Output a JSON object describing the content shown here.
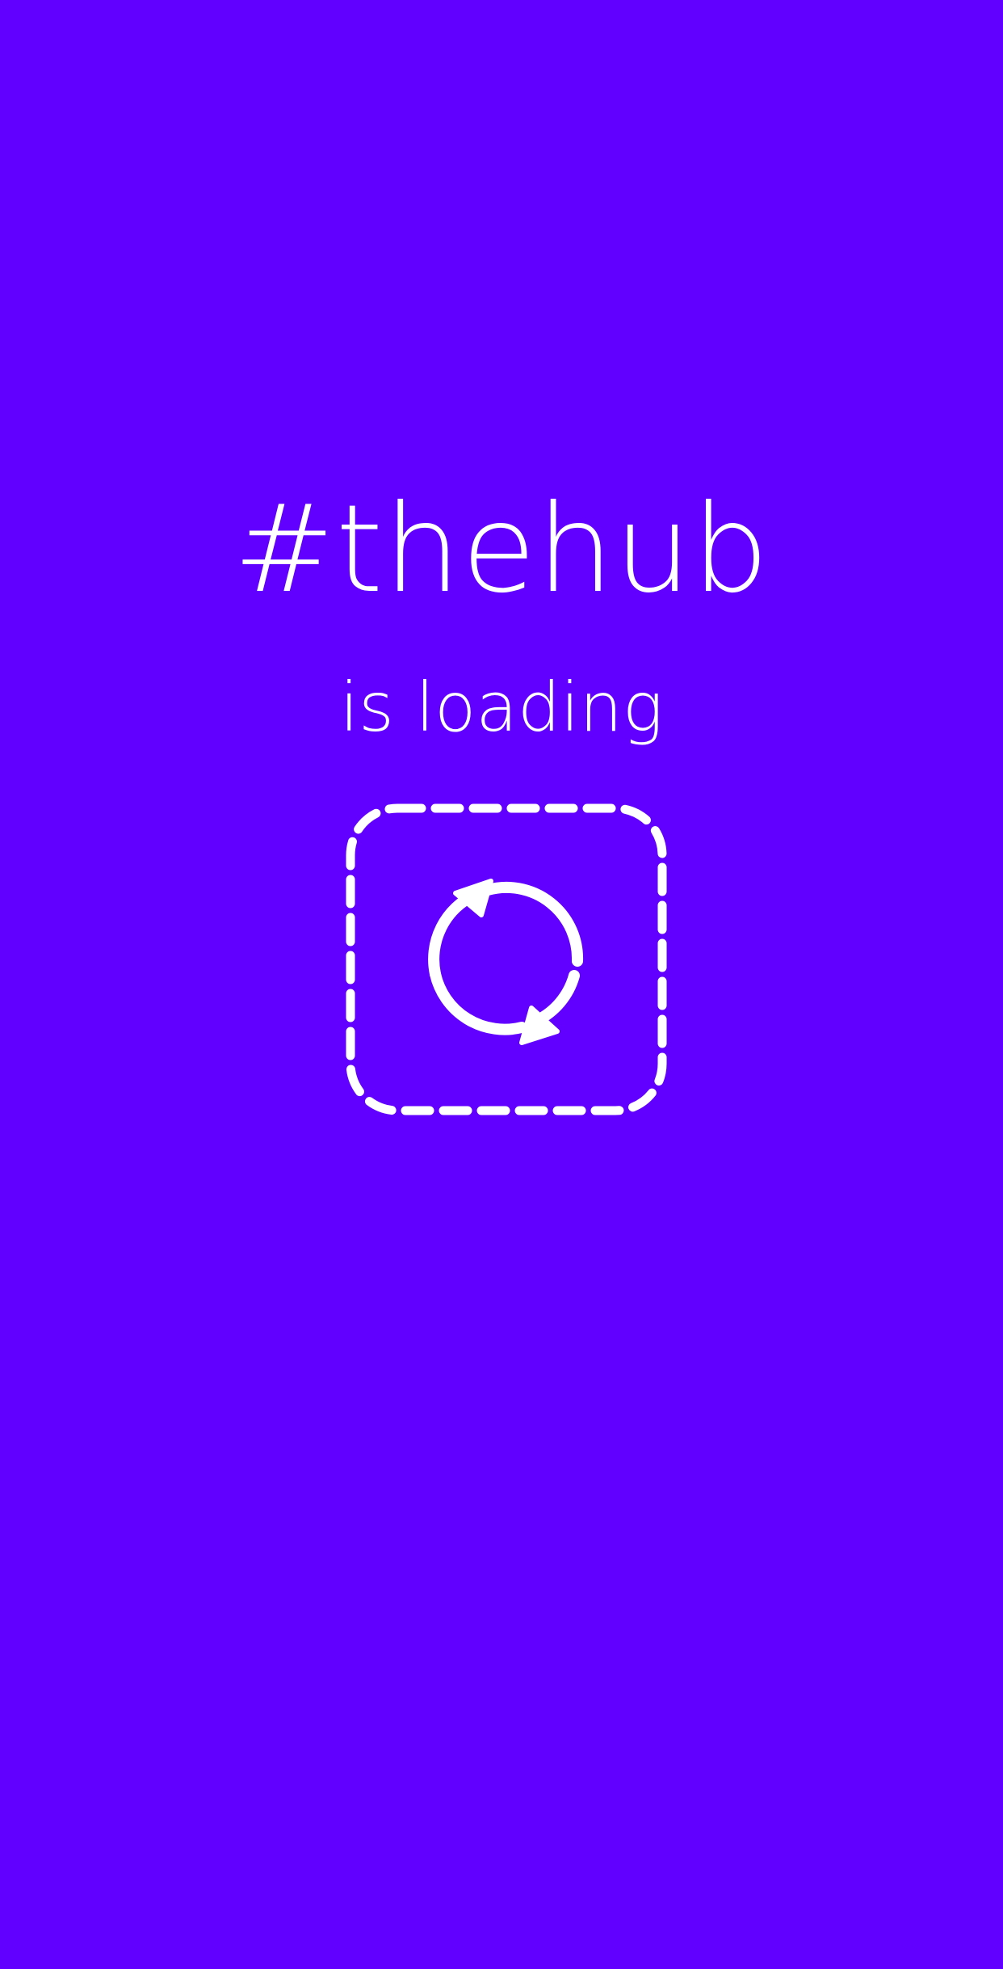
{
  "app": {
    "title": "#thehub",
    "status_text": "is loading"
  },
  "icons": {
    "loader_frame": "dashed-rounded-square-icon",
    "refresh": "refresh-icon"
  },
  "colors": {
    "background": "#6100ff",
    "foreground": "#ffffff"
  }
}
